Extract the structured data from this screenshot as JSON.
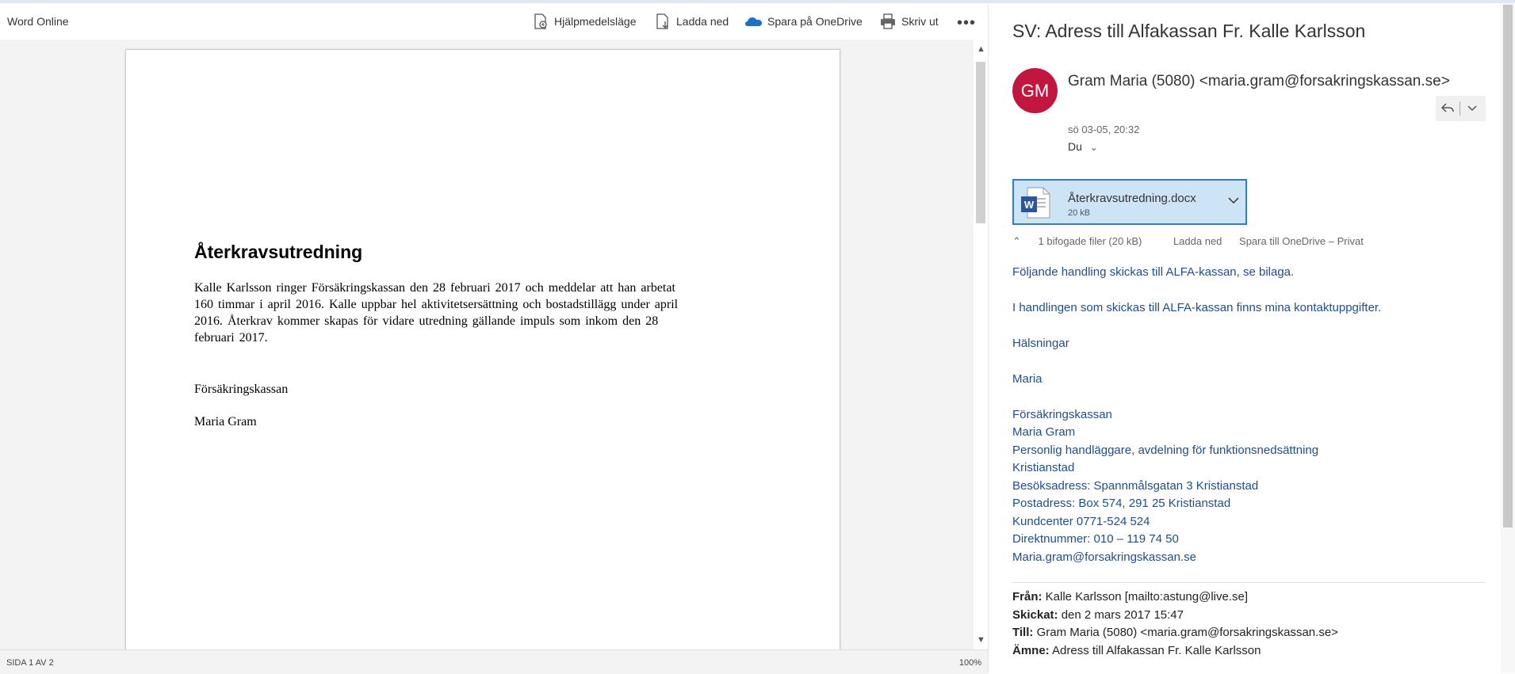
{
  "word": {
    "app_name": "Word Online",
    "toolbar": {
      "accessibility": "Hjälpmedelsläge",
      "download": "Ladda ned",
      "save_onedrive": "Spara på OneDrive",
      "print": "Skriv ut",
      "more": "•••"
    },
    "document": {
      "title": "Återkravsutredning",
      "paragraph": "Kalle Karlsson ringer Försäkringskassan den 28 februari 2017 och meddelar att han arbetat 160 timmar i april 2016. Kalle uppbar hel aktivitetsersättning och bostadstillägg under april 2016. Återkrav kommer skapas för vidare utredning gällande impuls som inkom den 28 februari 2017.",
      "signature_org": "Försäkringskassan",
      "signature_name": "Maria Gram"
    },
    "status": {
      "page": "SIDA 1 AV 2",
      "zoom": "100%"
    }
  },
  "mail": {
    "subject": "SV: Adress till Alfakassan Fr. Kalle Karlsson",
    "avatar_initials": "GM",
    "avatar_color": "#c1163f",
    "sender": "Gram Maria (5080) <maria.gram@forsakringskassan.se>",
    "date": "sö 03-05, 20:32",
    "to": "Du",
    "attachment": {
      "name": "Återkravsutredning.docx",
      "size": "20 kB"
    },
    "attachment_actions": {
      "summary": "1 bifogade filer (20 kB)",
      "download": "Ladda ned",
      "save": "Spara till OneDrive – Privat"
    },
    "body": {
      "line1": "Följande handling skickas till ALFA-kassan, se bilaga.",
      "line2": "I handlingen som skickas till ALFA-kassan finns mina kontaktuppgifter.",
      "greeting": "Hälsningar",
      "name": "Maria",
      "sig_org": "Försäkringskassan",
      "sig_name": "Maria Gram",
      "sig_title": "Personlig handläggare, avdelning för funktionsnedsättning",
      "sig_city": "Kristianstad",
      "sig_visit": "Besöksadress: Spannmålsgatan 3 Kristianstad",
      "sig_post": "Postadress: Box 574, 291 25 Kristianstad",
      "sig_customer": "Kundcenter 0771-524 524",
      "sig_direct": "Direktnummer: 010 – 119 74 50",
      "sig_email": "Maria.gram@forsakringskassan.se"
    },
    "quoted": {
      "from_label": "Från:",
      "from": "Kalle Karlsson [mailto:astung@live.se]",
      "sent_label": "Skickat:",
      "sent": "den 2 mars 2017 15:47",
      "to_label": "Till:",
      "to": "Gram Maria (5080) <maria.gram@forsakringskassan.se>",
      "subject_label": "Ämne:",
      "subject": "Adress till Alfakassan Fr. Kalle Karlsson"
    }
  }
}
